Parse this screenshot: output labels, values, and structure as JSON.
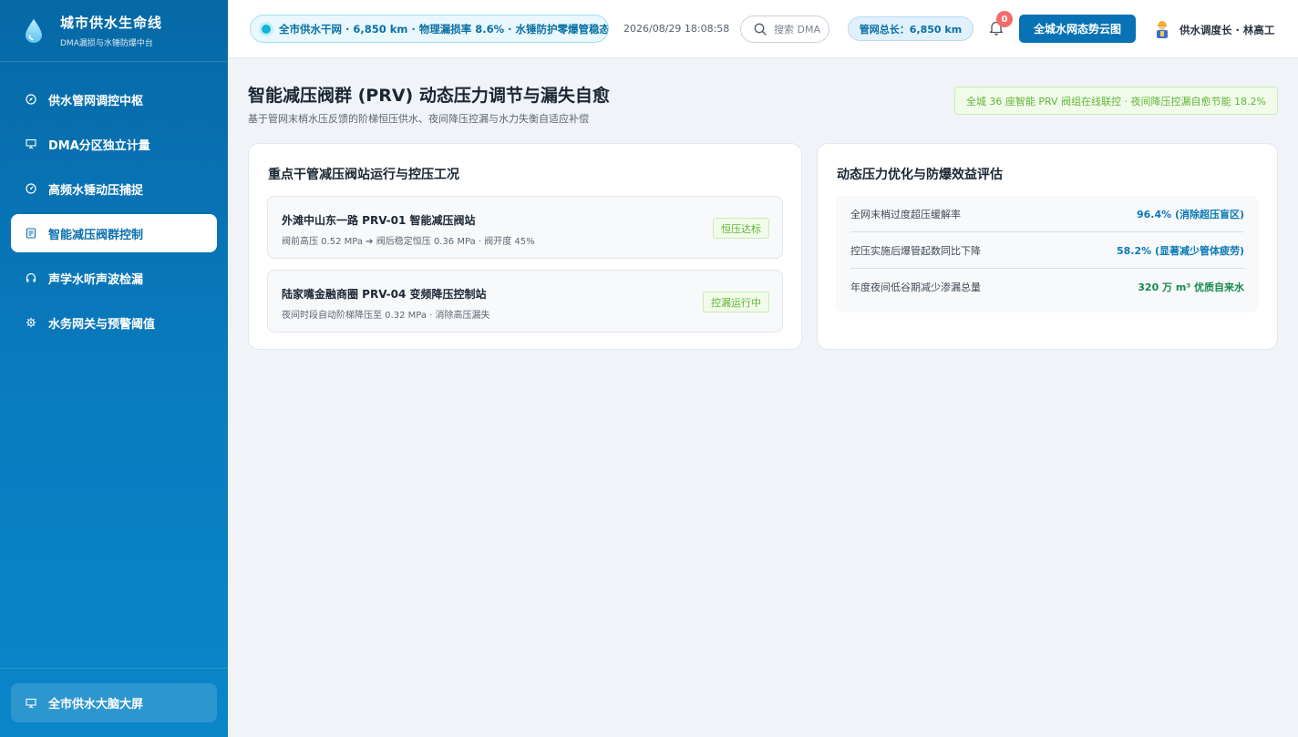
{
  "brand": {
    "title": "城市供水生命线",
    "subtitle": "DMA漏损与水锤防爆中台"
  },
  "sidebar": {
    "items": [
      {
        "label": "供水管网调控中枢",
        "icon": "compass-icon",
        "active": false
      },
      {
        "label": "DMA分区独立计量",
        "icon": "presentation-icon",
        "active": false
      },
      {
        "label": "高频水锤动压捕捉",
        "icon": "gauge-icon",
        "active": false
      },
      {
        "label": "智能减压阀群控制",
        "icon": "document-icon",
        "active": true
      },
      {
        "label": "声学水听声波检漏",
        "icon": "headphones-icon",
        "active": false
      },
      {
        "label": "水务网关与预警阈值",
        "icon": "gear-icon",
        "active": false
      }
    ],
    "bottom_label": "全市供水大脑大屏",
    "bottom_icon": "presentation-icon"
  },
  "header": {
    "status": "全市供水干网 · 6,850 km · 物理漏损率 8.6% · 水锤防护零爆管稳态",
    "datetime": "2026/08/29 18:08:58",
    "search_placeholder": "搜索 DMA",
    "network_length": "管网总长：6,850 km",
    "notification_count": "0",
    "cloud_button": "全城水网态势云图",
    "user": "供水调度长 · 林高工"
  },
  "main": {
    "title": "智能减压阀群 (PRV) 动态压力调节与漏失自愈",
    "subtitle": "基于管网末梢水压反馈的阶梯恒压供水、夜间降压控漏与水力失衡自适应补偿",
    "notice": "全城 36 座智能 PRV 阀组在线联控 · 夜间降压控漏自愈节能 18.2%"
  },
  "stations_card": {
    "title": "重点干管减压阀站运行与控压工况",
    "stations": [
      {
        "name": "外滩中山东一路 PRV-01 智能减压阀站",
        "detail": "阀前高压 0.52 MPa ➔ 阀后稳定恒压 0.36 MPa · 阀开度 45%",
        "tag": "恒压达标"
      },
      {
        "name": "陆家嘴金融商圈 PRV-04 变频降压控制站",
        "detail": "夜间时段自动阶梯降压至 0.32 MPa · 消除高压漏失",
        "tag": "控漏运行中"
      }
    ]
  },
  "metrics_card": {
    "title": "动态压力优化与防爆效益评估",
    "rows": [
      {
        "label": "全网末梢过度超压缓解率",
        "value": "96.4% (消除超压盲区)",
        "color": "#0a78b5"
      },
      {
        "label": "控压实施后爆管起数同比下降",
        "value": "58.2% (显著减少管体疲劳)",
        "color": "#0a78b5"
      },
      {
        "label": "年度夜间低谷期减少渗漏总量",
        "value": "320 万 m³ 优质自来水",
        "color": "#168a4e"
      }
    ]
  }
}
